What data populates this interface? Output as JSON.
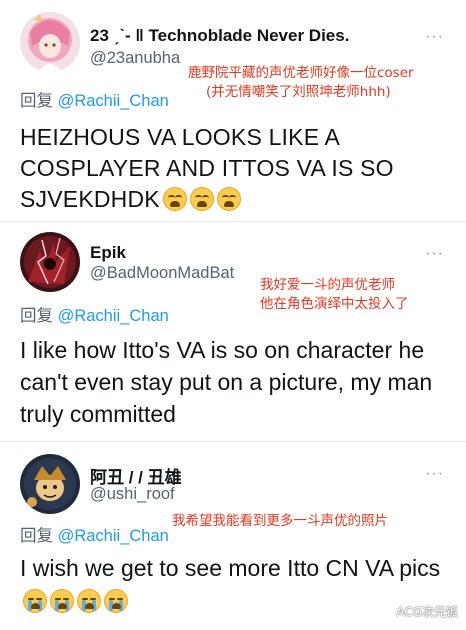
{
  "tweets": [
    {
      "name": "23 ˏˋ- ‖ Technoblade Never Dies.",
      "handle": "@23anubha",
      "more": "···",
      "reply_prefix": "回复 ",
      "reply_mention": "@Rachii_Chan",
      "text": "HEIZHOUS VA LOOKS LIKE A COSPLAYER AND ITTOS VA IS SO SJVEKDHDK",
      "emoji": [
        "weary-face",
        "weary-face",
        "weary-face"
      ],
      "annotation": [
        "鹿野院平藏的声优老师好像一位coser",
        "(并无情嘲笑了刘照坤老师hhh)"
      ]
    },
    {
      "name": "Epik",
      "handle": "@BadMoonMadBat",
      "more": "···",
      "reply_prefix": "回复 ",
      "reply_mention": "@Rachii_Chan",
      "text": "I like how Itto's VA is so on character he can't even stay put on a picture, my man truly committed",
      "annotation": [
        "我好爱一斗的声优老师",
        "他在角色演绎中太投入了"
      ]
    },
    {
      "name": "阿丑 / / 丑雄",
      "handle": "@ushi_roof",
      "more": "···",
      "reply_prefix": "回复 ",
      "reply_mention": "@Rachii_Chan",
      "text": "I wish we get to see more Itto CN VA pics",
      "emoji": [
        "crying-face",
        "crying-face",
        "crying-face",
        "crying-face"
      ],
      "annotation": [
        "我希望我能看到更多一斗声优的照片"
      ]
    }
  ],
  "watermark": "ACG次元饭",
  "colors": {
    "mention": "#1d9bf0",
    "annotation": "#e8371f",
    "secondary": "#536471"
  }
}
